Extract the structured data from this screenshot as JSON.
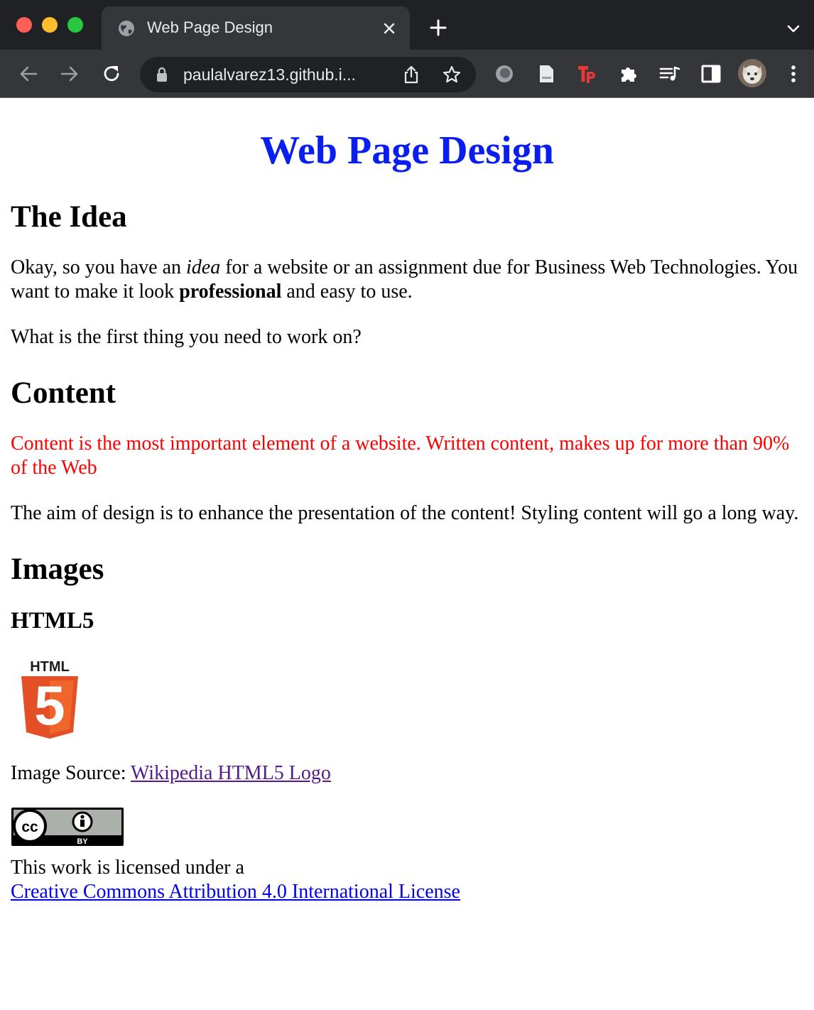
{
  "browser": {
    "tab_title": "Web Page Design",
    "url": "paulalvarez13.github.i...",
    "tab_title_color": "#e8eaed"
  },
  "page": {
    "title": "Web Page Design",
    "title_color": "#0a1ef0",
    "sections": {
      "idea": {
        "heading": "The Idea",
        "p1_before": "Okay, so you have an ",
        "p1_em": "idea",
        "p1_mid": " for a website or an assignment due for Business Web Technologies. You want to make it look ",
        "p1_strong": "professional",
        "p1_after": " and easy to use.",
        "p2": "What is the first thing you need to work on?"
      },
      "content": {
        "heading": "Content",
        "p1": "Content is the most important element of a website. Written content, makes up for more than 90% of the Web",
        "p1_color": "#ff0000",
        "p2": "The aim of design is to enhance the presentation of the content! Styling content will go a long way."
      },
      "images": {
        "heading": "Images",
        "subheading": "HTML5",
        "logo_text": "HTML",
        "logo_number": "5",
        "source_label": "Image Source: ",
        "source_link": "Wikipedia HTML5 Logo"
      },
      "license": {
        "badge_left": "cc",
        "badge_right": "BY",
        "text": "This work is licensed under a",
        "link": "Creative Commons Attribution 4.0 International License"
      }
    }
  }
}
